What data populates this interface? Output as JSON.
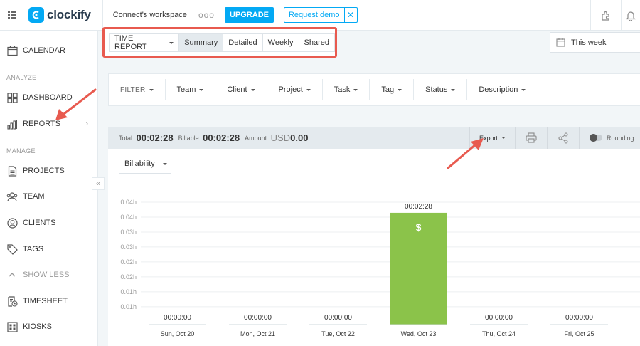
{
  "topbar": {
    "logo_text": "clockify",
    "workspace": "Connect's workspace",
    "more": "ooo",
    "upgrade_label": "UPGRADE",
    "request_demo_label": "Request demo",
    "close_glyph": "✕"
  },
  "sidebar": {
    "items": [
      {
        "label": "CALENDAR",
        "icon": "calendar-icon"
      },
      {
        "label": "DASHBOARD",
        "icon": "dashboard-icon"
      },
      {
        "label": "REPORTS",
        "icon": "reports-icon"
      },
      {
        "label": "PROJECTS",
        "icon": "projects-icon"
      },
      {
        "label": "TEAM",
        "icon": "team-icon"
      },
      {
        "label": "CLIENTS",
        "icon": "clients-icon"
      },
      {
        "label": "TAGS",
        "icon": "tag-icon"
      },
      {
        "label": "SHOW LESS",
        "icon": "chevron-up-icon"
      },
      {
        "label": "TIMESHEET",
        "icon": "timesheet-icon"
      },
      {
        "label": "KIOSKS",
        "icon": "kiosk-icon"
      }
    ],
    "section_analyze": "ANALYZE",
    "section_manage": "MANAGE",
    "reports_chevron": "›",
    "collapse_glyph": "«"
  },
  "report_tabs": {
    "dropdown_label": "TIME REPORT",
    "tabs": [
      "Summary",
      "Detailed",
      "Weekly",
      "Shared"
    ],
    "active": "Summary"
  },
  "date_range": {
    "label": "This week"
  },
  "filters": {
    "filter_label": "FILTER",
    "items": [
      "Team",
      "Client",
      "Project",
      "Task",
      "Tag",
      "Status",
      "Description"
    ]
  },
  "totals": {
    "total_label": "Total:",
    "total_value": "00:02:28",
    "billable_label": "Billable:",
    "billable_value": "00:02:28",
    "amount_label": "Amount:",
    "amount_currency": "USD",
    "amount_value": "0.00",
    "export_label": "Export",
    "rounding_label": "Rounding"
  },
  "billability_select": {
    "value": "Billability"
  },
  "colors": {
    "accent": "#03a9f4",
    "bar_green": "#8bc34a",
    "annotation_red": "#e85a4f"
  },
  "chart_data": {
    "type": "bar",
    "categories": [
      "Sun, Oct 20",
      "Mon, Oct 21",
      "Tue, Oct 22",
      "Wed, Oct 23",
      "Thu, Oct 24",
      "Fri, Oct 25"
    ],
    "values": [
      0,
      0,
      0,
      0.0411,
      0,
      0
    ],
    "value_labels": [
      "00:00:00",
      "00:00:00",
      "00:00:00",
      "00:02:28",
      "00:00:00",
      "00:00:00"
    ],
    "bar_symbol": "$",
    "y_ticks": [
      "0.04h",
      "0.04h",
      "0.03h",
      "0.03h",
      "0.02h",
      "0.02h",
      "0.01h",
      "0.01h"
    ],
    "ylim": [
      0,
      0.045
    ],
    "grid": true
  }
}
